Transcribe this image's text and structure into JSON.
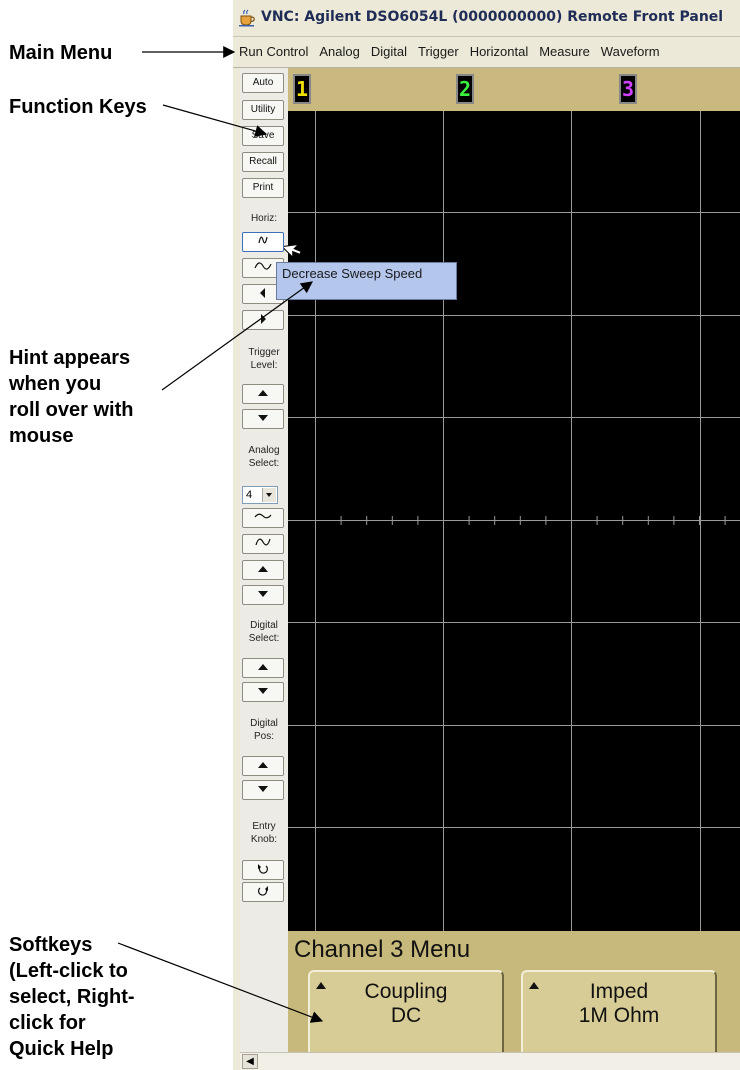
{
  "callouts": {
    "main_menu": "Main Menu",
    "function_keys": "Function Keys",
    "hint": "Hint appears\nwhen you\nroll over with\nmouse",
    "softkeys": "Softkeys\n(Left-click to\nselect, Right-\nclick for\nQuick Help"
  },
  "window": {
    "title": "VNC: Agilent DSO6054L (0000000000) Remote Front Panel",
    "icon": "java-cup-icon"
  },
  "menubar": {
    "items": [
      "Run Control",
      "Analog",
      "Digital",
      "Trigger",
      "Horizontal",
      "Measure",
      "Waveform"
    ]
  },
  "function_keys": [
    "Auto",
    "Utility",
    "Save",
    "Recall",
    "Print"
  ],
  "groups": {
    "horiz": "Horiz:",
    "trigger_level": "Trigger\nLevel:",
    "analog_select": "Analog\nSelect:",
    "digital_select": "Digital\nSelect:",
    "digital_pos": "Digital\nPos:",
    "entry_knob": "Entry\nKnob:"
  },
  "analog_select_value": "4",
  "channels": [
    {
      "label": "1",
      "color": "#f0e000"
    },
    {
      "label": "2",
      "color": "#3cf040"
    },
    {
      "label": "3",
      "color": "#d040ff"
    }
  ],
  "tooltip": "Decrease Sweep Speed",
  "softkey_menu": {
    "title": "Channel 3  Menu",
    "keys": [
      {
        "label": "Coupling",
        "value": "DC"
      },
      {
        "label": "Imped",
        "value": "1M Ohm"
      }
    ]
  },
  "colors": {
    "screen": "#000000",
    "grid": "#9a9a9a",
    "softkey_bar": "#c7b97b",
    "tooltip": "#b4c6ec"
  }
}
